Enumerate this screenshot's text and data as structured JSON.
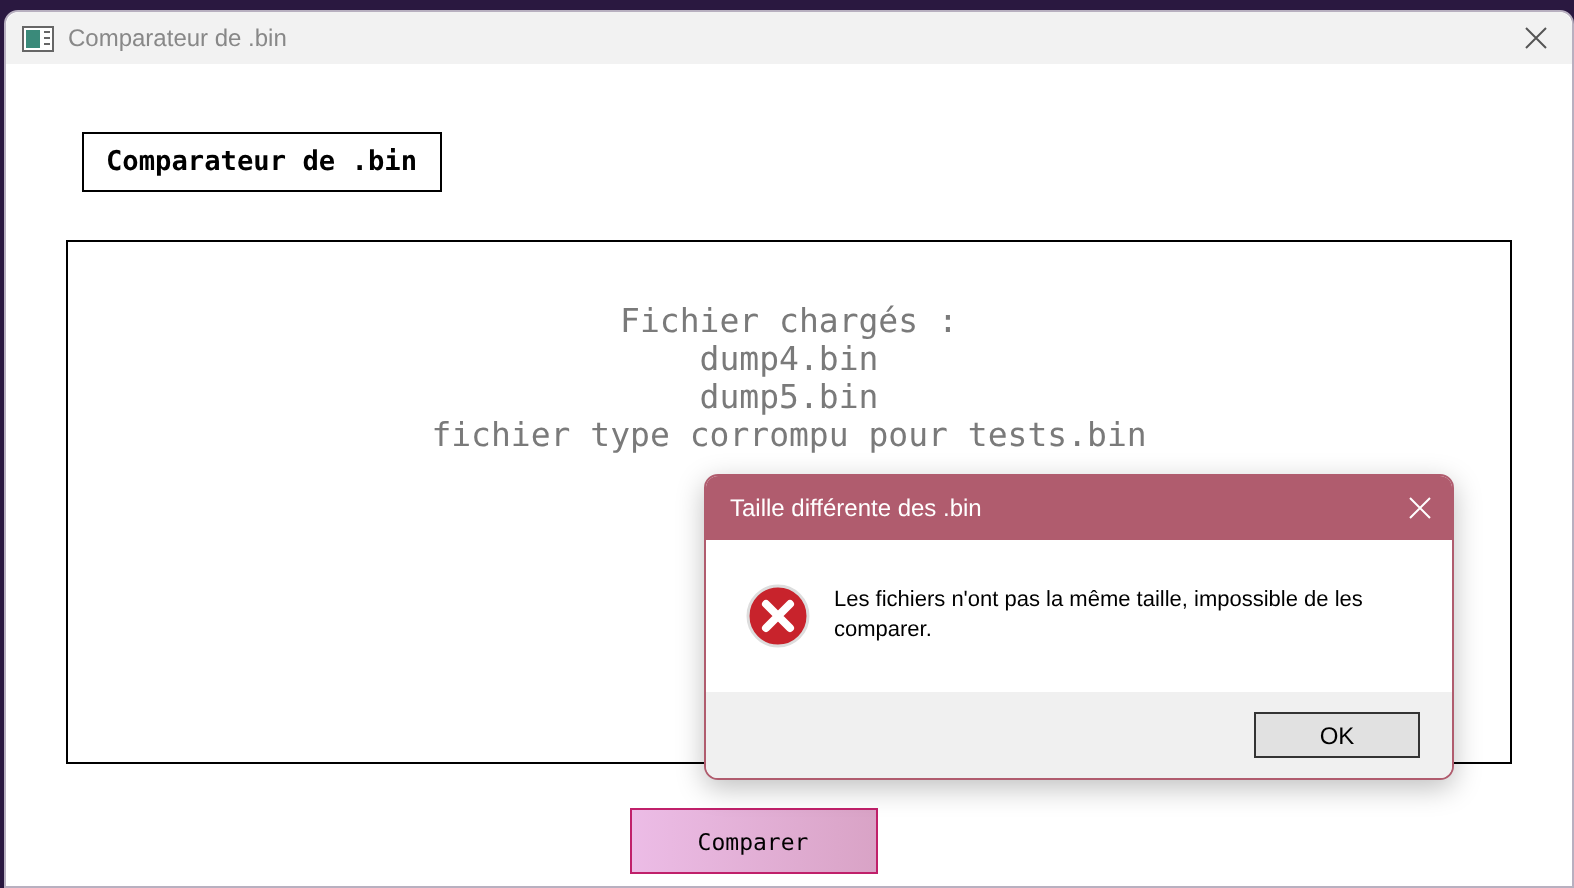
{
  "window": {
    "title": "Comparateur de .bin"
  },
  "header_label": "Comparateur de .bin",
  "loaded_files": [
    "Fichier chargés :",
    "dump4.bin",
    "dump5.bin",
    "fichier type corrompu pour tests.bin"
  ],
  "compare_button": "Comparer",
  "dialog": {
    "title": "Taille différente des .bin",
    "kind": "error",
    "message": "Les fichiers n'ont pas la même taille, impossible de les comparer.",
    "buttons": [
      "OK"
    ]
  }
}
